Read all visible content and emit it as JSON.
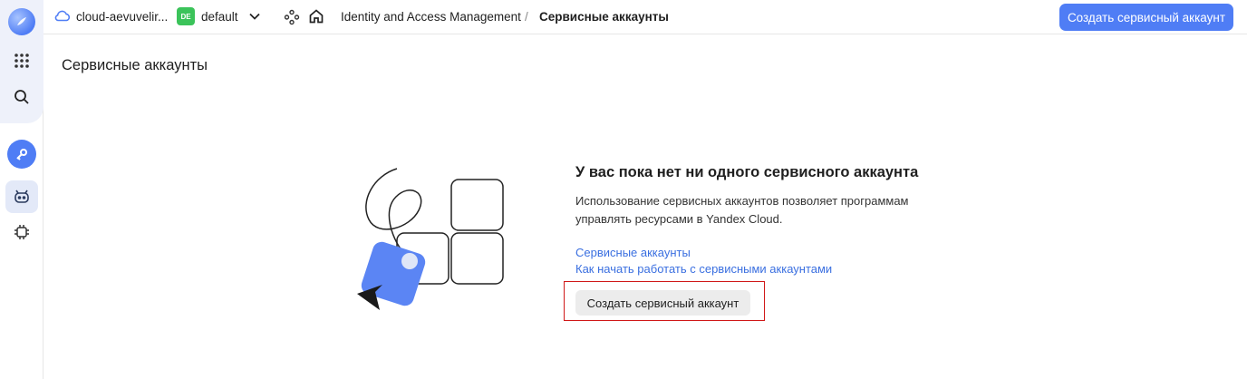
{
  "header": {
    "cloud_name": "cloud-aevuvelir...",
    "folder_badge": "DE",
    "folder_name": "default",
    "breadcrumb_service": "Identity and Access Management",
    "breadcrumb_separator": "/",
    "breadcrumb_current": "Сервисные аккаунты",
    "create_button": "Создать сервисный аккаунт"
  },
  "page": {
    "title": "Сервисные аккаунты"
  },
  "empty_state": {
    "title": "У вас пока нет ни одного сервисного аккаунта",
    "description": "Использование сервисных аккаунтов позволяет программам управлять ресурсами в Yandex Cloud.",
    "links": [
      "Сервисные аккаунты",
      "Как начать работать с сервисными аккаунтами"
    ],
    "create_button": "Создать сервисный аккаунт"
  },
  "colors": {
    "accent": "#4f7df5",
    "badge_green": "#3bc35a",
    "link": "#3a6fe0",
    "highlight_border": "#d01717"
  },
  "icons": [
    "logo-icon",
    "apps-grid-icon",
    "search-icon",
    "key-icon",
    "robot-icon",
    "chip-icon",
    "cloud-icon",
    "chevron-down-icon",
    "graph-icon",
    "home-icon"
  ]
}
